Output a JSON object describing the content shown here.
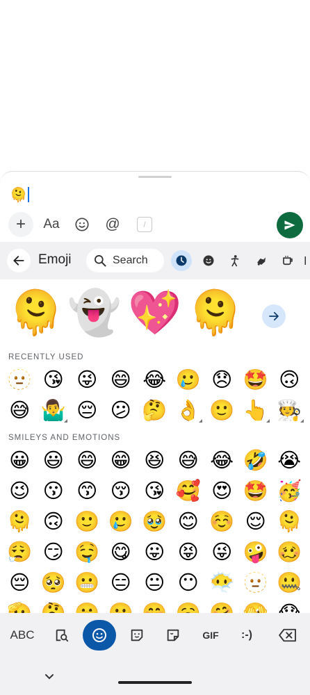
{
  "compose": {
    "input_emoji": "🫠",
    "toolbar": {
      "add_label": "+",
      "format_label": "Aa",
      "mention_label": "@",
      "slash_label": "/"
    }
  },
  "emoji_keyboard": {
    "title": "Emoji",
    "search_placeholder": "Search",
    "categories": [
      {
        "name": "recent",
        "icon": "clock-icon",
        "active": true
      },
      {
        "name": "smileys",
        "icon": "smiley-icon"
      },
      {
        "name": "people",
        "icon": "person-icon"
      },
      {
        "name": "animals",
        "icon": "animal-icon"
      },
      {
        "name": "food",
        "icon": "food-icon"
      }
    ],
    "featured": [
      "🫠",
      "👻",
      "💖",
      "🫠"
    ],
    "recently_used_label": "RECENTLY USED",
    "recently_used": [
      "🫥",
      "😘",
      "😜",
      "😄",
      "😂",
      "🥲",
      "😞",
      "🤩",
      "🙃",
      "😅",
      "🤷‍♂️",
      "😔",
      "😕",
      "🤔",
      "👌",
      "🙂",
      "👆",
      "🧑‍🍳"
    ],
    "smileys_label": "SMILEYS AND EMOTIONS",
    "smileys": [
      "😀",
      "😃",
      "😄",
      "😁",
      "😆",
      "😅",
      "😂",
      "🤣",
      "😭",
      "😉",
      "😗",
      "😙",
      "😚",
      "😘",
      "🥰",
      "😍",
      "🤩",
      "🥳",
      "🫠",
      "🙃",
      "🙂",
      "🥲",
      "🥹",
      "😊",
      "☺️",
      "😌",
      "🫠",
      "😮‍💨",
      "😏",
      "🤤",
      "😋",
      "😛",
      "😝",
      "😜",
      "🤪",
      "🥴",
      "😔",
      "🥺",
      "😬",
      "😑",
      "😐",
      "😶",
      "😶‍🌫️",
      "🫥",
      "🤐",
      "🫡",
      "🤔",
      "🤫",
      "🫢",
      "🤭",
      "🥱",
      "🤗",
      "🫣",
      "😱"
    ]
  },
  "bottom_bar": {
    "abc_label": "ABC",
    "gif_label": "GIF",
    "emoticon_label": ":-)"
  },
  "colors": {
    "send_button": "#0d6b3f",
    "active_tab": "#0b57a8",
    "active_category_bg": "#cfe3fb",
    "caret": "#1a73e8"
  }
}
